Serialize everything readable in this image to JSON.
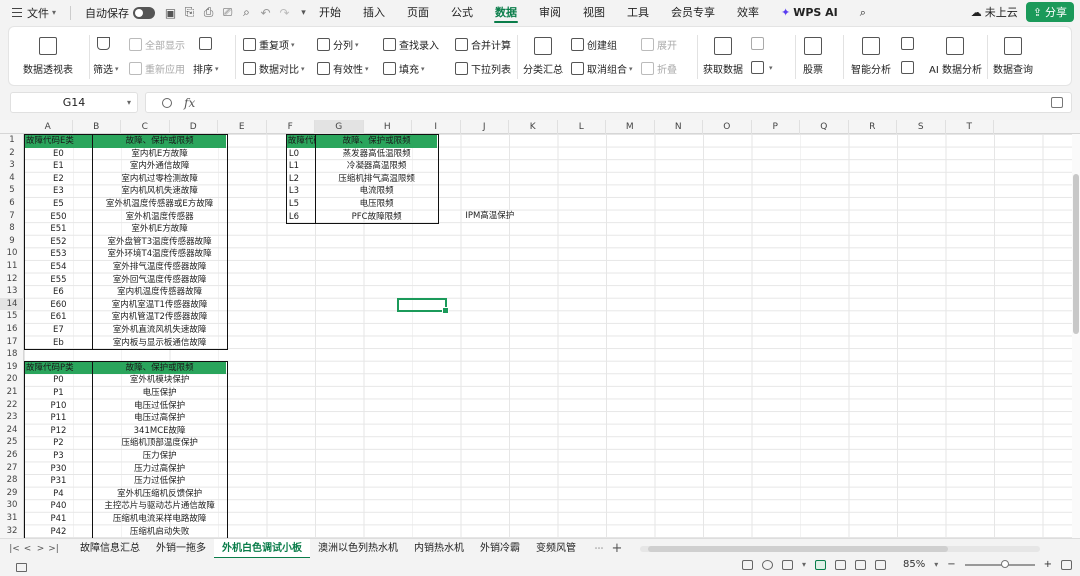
{
  "menubar": {
    "file_label": "文件",
    "autosave_label": "自动保存",
    "tabs": [
      "开始",
      "插入",
      "页面",
      "公式",
      "数据",
      "审阅",
      "视图",
      "工具",
      "会员专享",
      "效率"
    ],
    "active_tab": "数据",
    "wps_ai_label": "WPS AI",
    "cloud_label": "未上云",
    "share_label": "分享"
  },
  "ribbon": {
    "pivot": "数据透视表",
    "filter": "筛选",
    "show_all": "全部显示",
    "reapply": "重新应用",
    "sort": "排序",
    "duplicates": "重复项",
    "compare": "数据对比",
    "split": "分列",
    "validity": "有效性",
    "find_entry": "查找录入",
    "fill": "填充",
    "merge_calc": "合并计算",
    "dropdown_list": "下拉列表",
    "subtotal": "分类汇总",
    "create_group": "创建组",
    "ungroup": "取消组合",
    "expand": "展开",
    "collapse": "折叠",
    "get_data": "获取数据",
    "stocks": "股票",
    "smart_analysis": "智能分析",
    "ai_analysis": "AI 数据分析",
    "data_query": "数据查询"
  },
  "formula_bar": {
    "name_box": "G14",
    "fx_label": "fx",
    "formula": ""
  },
  "columns": [
    "A",
    "B",
    "C",
    "D",
    "E",
    "F",
    "G",
    "H",
    "I",
    "J",
    "K",
    "L",
    "M",
    "N",
    "O",
    "P",
    "Q",
    "R",
    "S",
    "T"
  ],
  "selected_column": "G",
  "selected_row": "14",
  "rows": [
    "1",
    "2",
    "3",
    "4",
    "5",
    "6",
    "7",
    "8",
    "9",
    "10",
    "11",
    "12",
    "13",
    "14",
    "15",
    "16",
    "17",
    "18",
    "19",
    "20",
    "21",
    "22",
    "23",
    "24",
    "25",
    "26",
    "27",
    "28",
    "29",
    "30",
    "31",
    "32"
  ],
  "table_e": {
    "header": [
      "故障代码E类",
      "故障、保护或限频"
    ],
    "rows": [
      [
        "E0",
        "室内机E方故障"
      ],
      [
        "E1",
        "室内外通信故障"
      ],
      [
        "E2",
        "室内机过零检测故障"
      ],
      [
        "E3",
        "室内机风机失速故障"
      ],
      [
        "E5",
        "室外机温度传感器或E方故障"
      ],
      [
        "E50",
        "室外机温度传感器"
      ],
      [
        "E51",
        "室外机E方故障"
      ],
      [
        "E52",
        "室外盘管T3温度传感器故障"
      ],
      [
        "E53",
        "室外环境T4温度传感器故障"
      ],
      [
        "E54",
        "室外排气温度传感器故障"
      ],
      [
        "E55",
        "室外回气温度传感器故障"
      ],
      [
        "E6",
        "室内机温度传感器故障"
      ],
      [
        "E60",
        "室内机室温T1传感器故障"
      ],
      [
        "E61",
        "室内机管温T2传感器故障"
      ],
      [
        "E7",
        "室外机直流风机失速故障"
      ],
      [
        "Eb",
        "室内板与显示板通信故障"
      ]
    ]
  },
  "table_p": {
    "header": [
      "故障代码P类",
      "故障、保护或限频"
    ],
    "rows": [
      [
        "P0",
        "室外机模块保护"
      ],
      [
        "P1",
        "电压保护"
      ],
      [
        "P10",
        "电压过低保护"
      ],
      [
        "P11",
        "电压过高保护"
      ],
      [
        "P12",
        "341MCE故障"
      ],
      [
        "P2",
        "压缩机顶部温度保护"
      ],
      [
        "P3",
        "压力保护"
      ],
      [
        "P30",
        "压力过高保护"
      ],
      [
        "P31",
        "压力过低保护"
      ],
      [
        "P4",
        "室外机压缩机反馈保护"
      ],
      [
        "P40",
        "主控芯片与驱动芯片通信故障"
      ],
      [
        "P41",
        "压缩机电流采样电路故障"
      ],
      [
        "P42",
        "压缩机启动失败"
      ]
    ]
  },
  "table_l": {
    "header": [
      "故障代码L类",
      "故障、保护或限频"
    ],
    "rows": [
      [
        "L0",
        "蒸发器高低温限频"
      ],
      [
        "L1",
        "冷凝器高温限频"
      ],
      [
        "L2",
        "压缩机排气高温限频"
      ],
      [
        "L3",
        "电流限频"
      ],
      [
        "L5",
        "电压限频"
      ],
      [
        "L6",
        "PFC故障限频"
      ]
    ]
  },
  "note_h7": "IPM高温保护",
  "sheet_tabs": [
    "故障信息汇总",
    "外销一拖多",
    "外机白色调试小板",
    "澳洲以色列热水机",
    "内销热水机",
    "外销冷霸",
    "变频风管"
  ],
  "active_sheet": "外机白色调试小板",
  "status": {
    "zoom": "85%"
  }
}
